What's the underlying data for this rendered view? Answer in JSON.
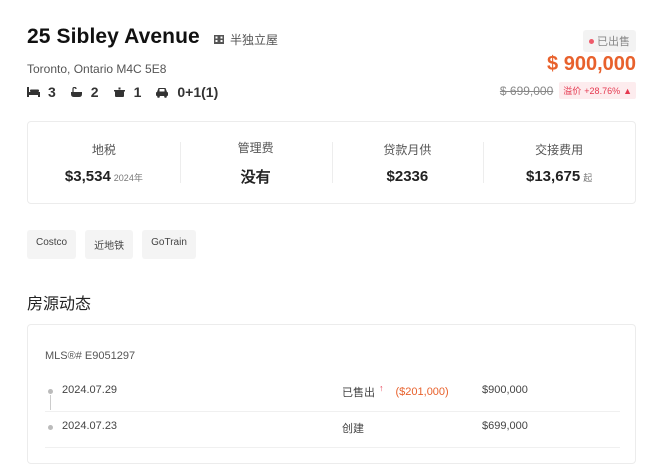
{
  "listing": {
    "title": "25 Sibley Avenue",
    "type_icon": "building-icon",
    "type": "半独立屋",
    "address": "Toronto, Ontario M4C 5E8",
    "specs": [
      {
        "icon": "bed-icon",
        "value": "3"
      },
      {
        "icon": "bathtub-icon",
        "value": "2"
      },
      {
        "icon": "kitchen-icon",
        "value": "1"
      },
      {
        "icon": "car-icon",
        "value": "0+1(1)"
      }
    ]
  },
  "price": {
    "status": "已出售",
    "sold": "$ 900,000",
    "original": "$ 699,000",
    "premium_label": "溢价",
    "premium_value": "+28.76%",
    "accent": "#e8612c",
    "premium_color": "#e53950"
  },
  "stats": [
    {
      "label": "地税",
      "value": "$3,534",
      "suffix": "2024年"
    },
    {
      "label": "管理费",
      "value": "没有",
      "suffix": ""
    },
    {
      "label": "贷款月供",
      "value": "$2336",
      "suffix": ""
    },
    {
      "label": "交接费用",
      "value": "$13,675",
      "suffix": "起"
    }
  ],
  "tags": [
    "Costco",
    "近地铁",
    "GoTrain"
  ],
  "history": {
    "title": "房源动态",
    "mls": "MLS®# E9051297",
    "rows": [
      {
        "date": "2024.07.29",
        "status": "已售出",
        "diff": "($201,000)",
        "price": "$900,000"
      },
      {
        "date": "2024.07.23",
        "status": "创建",
        "diff": "",
        "price": "$699,000"
      }
    ]
  }
}
